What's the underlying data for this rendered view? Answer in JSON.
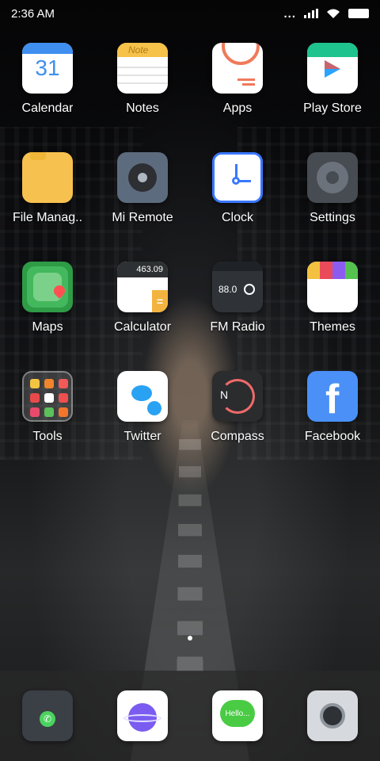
{
  "status_bar": {
    "time": "2:36 AM",
    "signal_dots": "..."
  },
  "grid": {
    "row1": [
      {
        "label": "Calendar",
        "icon": "calendar-icon",
        "date": "31"
      },
      {
        "label": "Notes",
        "icon": "notes-icon",
        "script": "Note"
      },
      {
        "label": "Apps",
        "icon": "apps-icon"
      },
      {
        "label": "Play Store",
        "icon": "play-store-icon"
      }
    ],
    "row2": [
      {
        "label": "File Manag..",
        "icon": "file-manager-icon"
      },
      {
        "label": "Mi Remote",
        "icon": "mi-remote-icon"
      },
      {
        "label": "Clock",
        "icon": "clock-icon"
      },
      {
        "label": "Settings",
        "icon": "settings-gear-icon"
      }
    ],
    "row3": [
      {
        "label": "Maps",
        "icon": "maps-icon"
      },
      {
        "label": "Calculator",
        "icon": "calculator-icon",
        "display": "463.09"
      },
      {
        "label": "FM Radio",
        "icon": "fm-radio-icon",
        "freq": "88.0"
      },
      {
        "label": "Themes",
        "icon": "themes-icon"
      }
    ],
    "row4": [
      {
        "label": "Tools",
        "icon": "tools-folder-icon"
      },
      {
        "label": "Twitter",
        "icon": "twitter-icon"
      },
      {
        "label": "Compass",
        "icon": "compass-icon",
        "n": "N"
      },
      {
        "label": "Facebook",
        "icon": "facebook-icon",
        "f": "f"
      }
    ]
  },
  "dock": [
    {
      "icon": "phone-icon"
    },
    {
      "icon": "browser-icon"
    },
    {
      "icon": "messages-icon",
      "text": "Hello..."
    },
    {
      "icon": "camera-icon"
    }
  ],
  "colors": {
    "accent_blue": "#3f8ff0",
    "notes_yellow": "#f6c24a",
    "play_green": "#1ec38d",
    "clock_blue": "#3a78ff",
    "maps_green": "#2e9b46",
    "facebook_blue": "#4a90f7"
  }
}
